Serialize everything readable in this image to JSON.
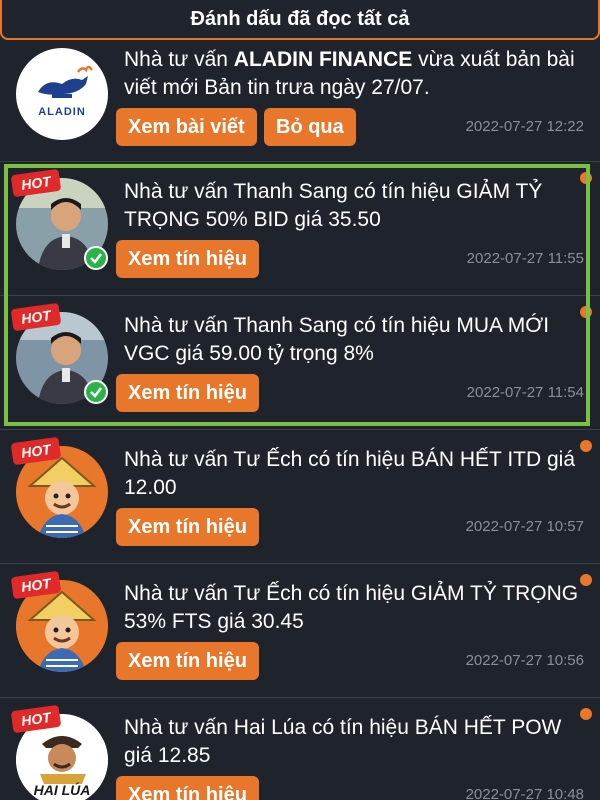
{
  "header": {
    "mark_all_read": "Đánh dấu đã đọc tất cả"
  },
  "colors": {
    "accent": "#e8772c",
    "highlight": "#7ac142",
    "background": "#1f232b",
    "hot": "#e02a2a"
  },
  "hot_label": "HOT",
  "items": [
    {
      "avatar": "aladin-logo",
      "avatar_text": "ALADIN",
      "text_prefix": "Nhà tư vấn ",
      "text_bold": "ALADIN FINANCE",
      "text_suffix": " vừa xuất bản bài viết mới Bản tin trưa ngày 27/07.",
      "button_primary": "Xem bài viết",
      "button_secondary": "Bỏ qua",
      "time": "2022-07-27 12:22"
    },
    {
      "avatar": "thanh-sang-photo",
      "text": "Nhà tư vấn Thanh Sang có tín hiệu GIẢM TỶ TRỌNG 50% BID giá 35.50",
      "button": "Xem tín hiệu",
      "time": "2022-07-27 11:55"
    },
    {
      "avatar": "thanh-sang-photo",
      "text": "Nhà tư vấn Thanh Sang có tín hiệu MUA MỚI VGC giá 59.00 tỷ trọng 8%",
      "button": "Xem tín hiệu",
      "time": "2022-07-27 11:54"
    },
    {
      "avatar": "tu-ech-cartoon",
      "text": "Nhà tư vấn Tư Ếch có tín hiệu BÁN HẾT ITD giá 12.00",
      "button": "Xem tín hiệu",
      "time": "2022-07-27 10:57"
    },
    {
      "avatar": "tu-ech-cartoon",
      "text": "Nhà tư vấn Tư Ếch có tín hiệu GIẢM TỶ TRỌNG 53% FTS giá 30.45",
      "button": "Xem tín hiệu",
      "time": "2022-07-27 10:56"
    },
    {
      "avatar": "hai-lua-cartoon",
      "avatar_text": "HAI LÚA",
      "text": "Nhà tư vấn Hai Lúa có tín hiệu BÁN HẾT POW giá 12.85",
      "button": "Xem tín hiệu",
      "time": "2022-07-27 10:48"
    }
  ]
}
